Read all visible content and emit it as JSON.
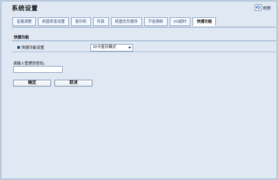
{
  "window": {
    "title": "系统设置",
    "refresh_label": "刷新"
  },
  "tabs": [
    {
      "label": "音量调整",
      "active": false
    },
    {
      "label": "纸盘纸张设置",
      "active": false
    },
    {
      "label": "复印机",
      "active": false
    },
    {
      "label": "传真",
      "active": false
    },
    {
      "label": "纸盘优先顺序",
      "active": false
    },
    {
      "label": "节省钢粉",
      "active": false
    },
    {
      "label": "I/O超时",
      "active": false
    },
    {
      "label": "快捷功能",
      "active": true
    }
  ],
  "section": {
    "title": "快捷功能",
    "rows": [
      {
        "label": "快捷功能设置",
        "value": "ID卡复印模式"
      }
    ]
  },
  "password": {
    "label": "请输入管理员密码。",
    "value": ""
  },
  "buttons": {
    "ok_label": "确定",
    "cancel_label": "取消"
  },
  "colors": {
    "background": "#dfe8f3",
    "accent": "#2b4a7a",
    "border": "#8da4c4"
  }
}
